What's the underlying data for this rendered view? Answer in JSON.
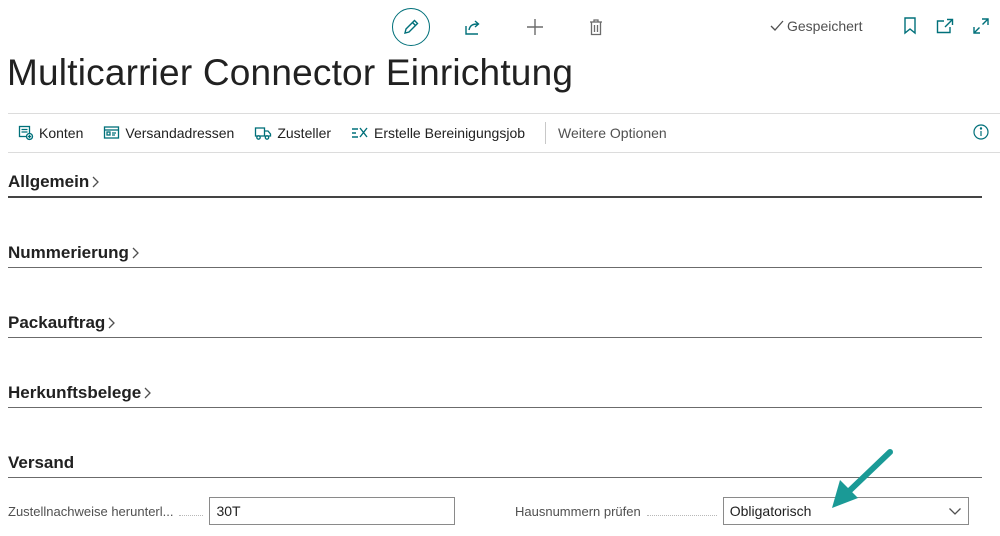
{
  "toolbar": {
    "edit_icon": "pencil-icon",
    "share_icon": "share-icon",
    "new_icon": "plus-icon",
    "delete_icon": "trash-icon",
    "saved_label": "Gespeichert",
    "bookmark_icon": "bookmark-icon",
    "popout_icon": "popout-icon",
    "expand_icon": "expand-icon"
  },
  "page": {
    "title": "Multicarrier Connector Einrichtung"
  },
  "actions": {
    "items": [
      {
        "label": "Konten",
        "icon": "accounts-icon"
      },
      {
        "label": "Versandadressen",
        "icon": "addresses-icon"
      },
      {
        "label": "Zusteller",
        "icon": "carrier-icon"
      },
      {
        "label": "Erstelle Bereinigungsjob",
        "icon": "cleanup-icon"
      }
    ],
    "more_label": "Weitere Optionen",
    "info_icon": "info-icon"
  },
  "sections": [
    {
      "title": "Allgemein",
      "collapsed": true
    },
    {
      "title": "Nummerierung",
      "collapsed": true
    },
    {
      "title": "Packauftrag",
      "collapsed": true
    },
    {
      "title": "Herkunftsbelege",
      "collapsed": true
    },
    {
      "title": "Versand",
      "collapsed": false
    }
  ],
  "versand": {
    "proof_download": {
      "label": "Zustellnachweise herunterl...",
      "value": "30T"
    },
    "house_number_check": {
      "label": "Hausnummern prüfen",
      "value": "Obligatorisch"
    }
  },
  "colors": {
    "accent": "#00707a",
    "annotation": "#1a9a96"
  }
}
